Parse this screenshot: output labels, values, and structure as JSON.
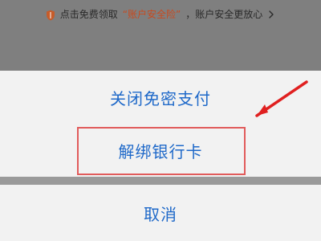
{
  "notice": {
    "before": "点击免费领取",
    "highlight": "“账户安全险”",
    "after": "，账户安全更放心"
  },
  "actions": {
    "item1": "关闭免密支付",
    "item2": "解绑银行卡",
    "cancel": "取消"
  },
  "colors": {
    "overlay": "#7f7f7f",
    "sheet": "#f2f2f2",
    "action_blue": "#1f69c9",
    "accent_red": "#e15b5b",
    "highlight_orange": "#c84a1f"
  }
}
